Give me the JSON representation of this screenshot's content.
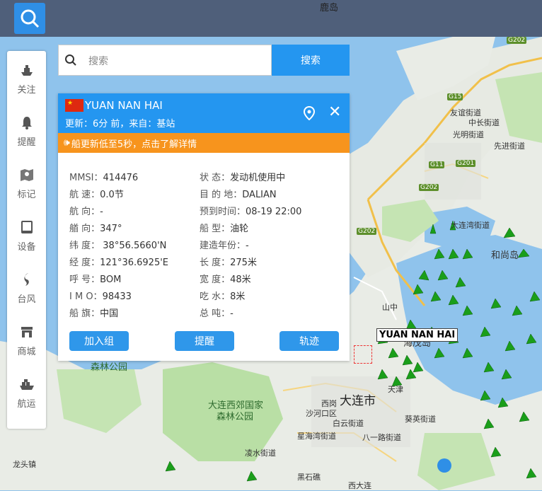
{
  "topbar": {
    "place_label": "鹿岛"
  },
  "search": {
    "placeholder": "搜索",
    "button_label": "搜索"
  },
  "sidebar": {
    "items": [
      {
        "label": "关注",
        "icon": "ship-follow-icon"
      },
      {
        "label": "提醒",
        "icon": "bell-icon"
      },
      {
        "label": "标记",
        "icon": "map-marker-icon"
      },
      {
        "label": "设备",
        "icon": "tablet-icon"
      },
      {
        "label": "台风",
        "icon": "typhoon-icon"
      },
      {
        "label": "商城",
        "icon": "store-icon"
      },
      {
        "label": "航运",
        "icon": "cargo-ship-icon"
      }
    ]
  },
  "panel": {
    "ship_name": "YUAN NAN HAI",
    "update_text": "更新：6分 前，来自：基站",
    "notice_text": "船更新低至5秒，点击了解详情",
    "left_fields": [
      {
        "label": "MMSI：",
        "value": "414476"
      },
      {
        "label": "航 速：",
        "value": "0.0节"
      },
      {
        "label": "航 向：",
        "value": "-"
      },
      {
        "label": "艏 向：",
        "value": "347°"
      },
      {
        "label": "纬 度：",
        "value": " 38°56.5660'N"
      },
      {
        "label": "经 度：",
        "value": "121°36.6925'E"
      },
      {
        "label": "呼 号：",
        "value": "BOM"
      },
      {
        "label": "I M O：",
        "value": "98433"
      },
      {
        "label": "船 旗：",
        "value": "中国"
      }
    ],
    "right_fields": [
      {
        "label": "状 态：",
        "value": "发动机使用中"
      },
      {
        "label": "目 的 地：",
        "value": "DALIAN"
      },
      {
        "label": "预到时间：",
        "value": "08-19 22:00"
      },
      {
        "label": "船 型：",
        "value": "油轮"
      },
      {
        "label": "建造年份：",
        "value": "-"
      },
      {
        "label": "长 度：",
        "value": "275米"
      },
      {
        "label": "宽 度：",
        "value": "48米"
      },
      {
        "label": "吃 水：",
        "value": "8米"
      },
      {
        "label": "总 吨：",
        "value": "-"
      }
    ],
    "buttons": {
      "add_group": "加入组",
      "alert": "提醒",
      "track": "轨迹"
    }
  },
  "map": {
    "ship_label": "YUAN NAN HAI",
    "labels": {
      "city": "大连市",
      "park1": "大连西郊国家",
      "park2": "森林公园",
      "park_top": "森林公园",
      "island": "海茂岛",
      "heshang": "和尚岛",
      "shanshang": "山中",
      "dalian_port": "大连湾街道",
      "youhao": "友谊街道",
      "zhongchang": "中长街道",
      "guangming": "光明街道",
      "xianjin": "先进街道",
      "tianjin": "天津",
      "xigang": "西岗",
      "shahekou": "沙河口区",
      "baiyunshan": "白云街道",
      "xingyuan": "星海湾街道",
      "lingshui": "凌水街道",
      "heishijiao": "黑石礁",
      "xidajian": "西大连",
      "longtou": "龙头镇",
      "kuisheng": "葵英街道",
      "bayi": "八一路街道"
    },
    "road_shields": [
      "G202",
      "G15",
      "G11",
      "G201",
      "G202",
      "G202"
    ]
  },
  "colors": {
    "accent": "#2496f0",
    "notice": "#f7941d",
    "ship_marker": "#1a9e1a",
    "sea": "#8fc3ec",
    "land": "#e9ece6",
    "park": "#b9dfa5"
  }
}
